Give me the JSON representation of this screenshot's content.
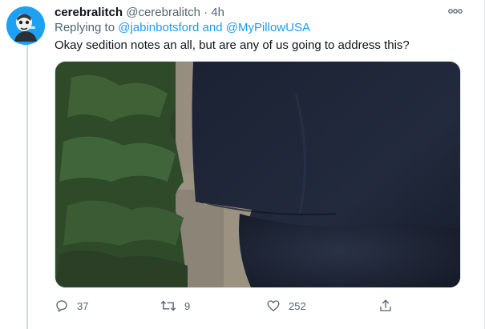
{
  "tweet": {
    "display_name": "cerebralitch",
    "handle": "@cerebralitch",
    "separator": "·",
    "time": "4h",
    "replying_prefix": "Replying to",
    "mention_1": "@jabinbotsford",
    "mention_joiner": "and",
    "mention_2": "@MyPillowUSA",
    "text": "Okay sedition notes an all, but are any of us going to address this?",
    "more_icon": "more-dots-icon"
  },
  "actions": {
    "reply_count": "37",
    "retweet_count": "9",
    "like_count": "252"
  },
  "colors": {
    "link": "#1d9bf0",
    "muted": "#536471",
    "avatar_bg": "#1da1f2"
  }
}
